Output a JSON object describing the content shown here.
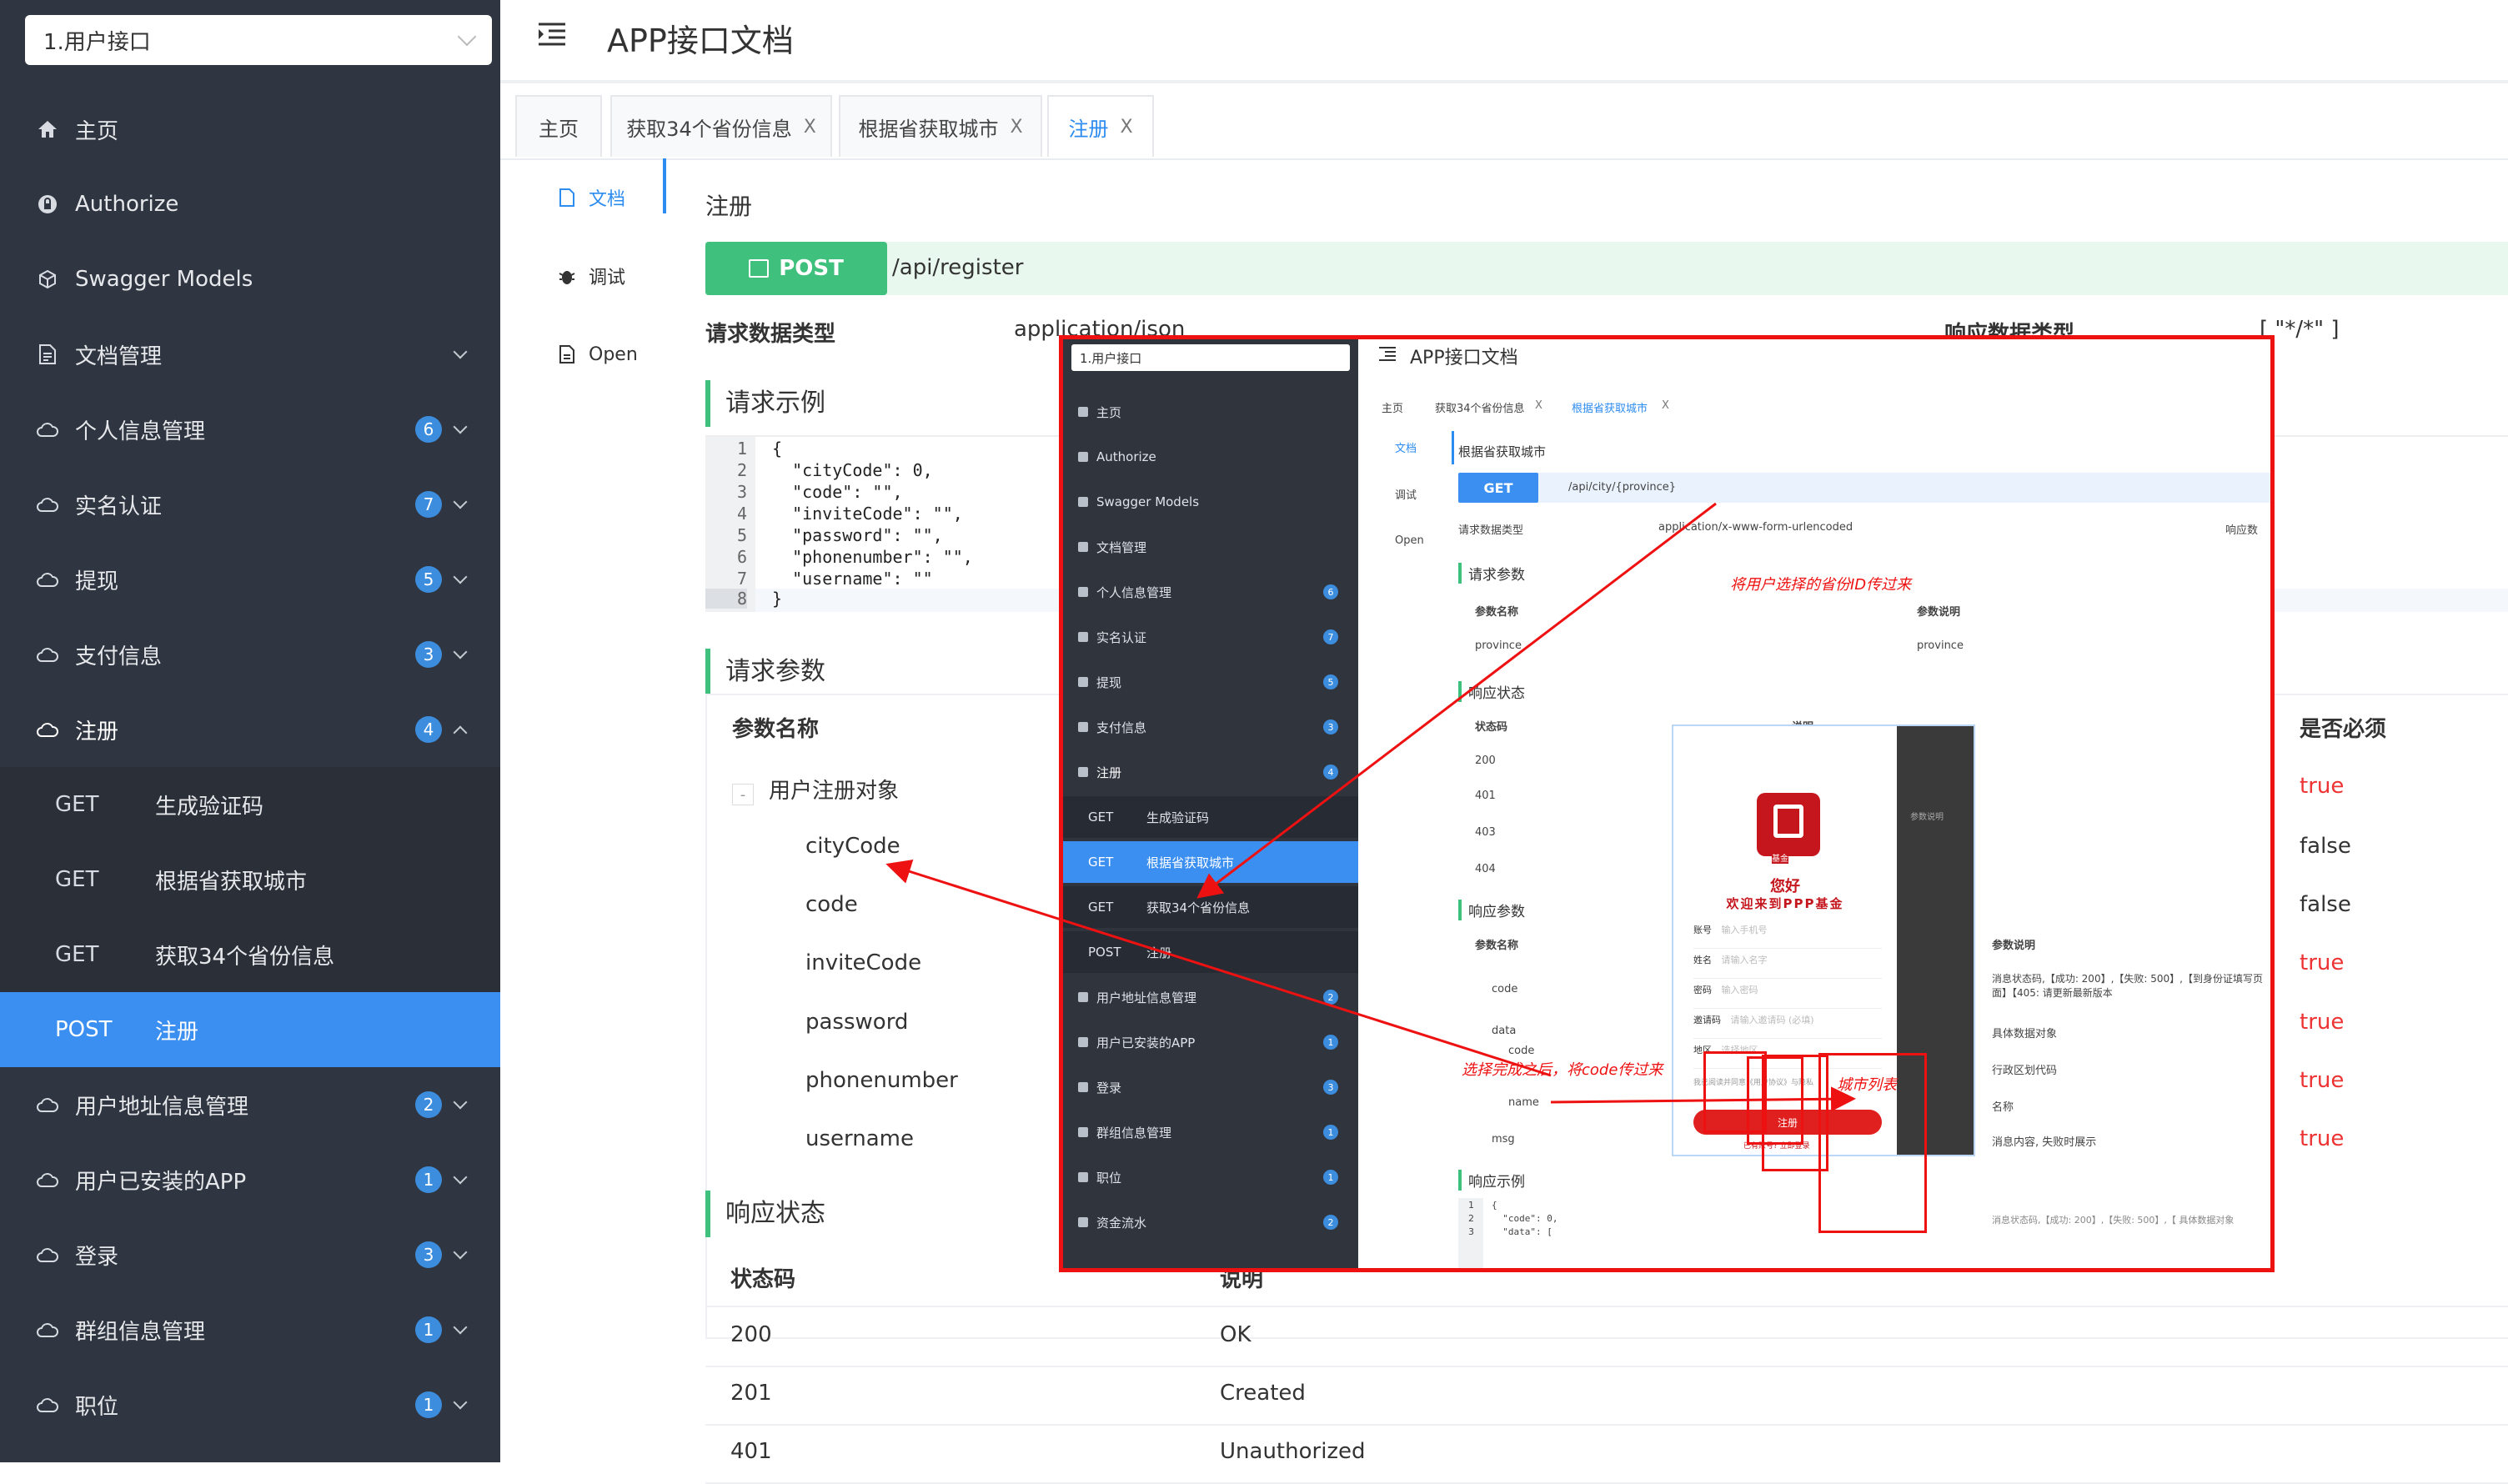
{
  "sidebar": {
    "select_value": "1.用户接口",
    "items": [
      {
        "label": "主页",
        "icon": "home-icon"
      },
      {
        "label": "Authorize",
        "icon": "lock-icon"
      },
      {
        "label": "Swagger Models",
        "icon": "cube-icon"
      },
      {
        "label": "文档管理",
        "icon": "document-icon"
      },
      {
        "label": "个人信息管理",
        "badge": "6",
        "icon": "cloud-icon"
      },
      {
        "label": "实名认证",
        "badge": "7",
        "icon": "cloud-icon"
      },
      {
        "label": "提现",
        "badge": "5",
        "icon": "cloud-icon"
      },
      {
        "label": "支付信息",
        "badge": "3",
        "icon": "cloud-icon"
      },
      {
        "label": "注册",
        "badge": "4",
        "icon": "cloud-icon"
      }
    ],
    "sub_items": [
      {
        "method": "GET",
        "label": "生成验证码"
      },
      {
        "method": "GET",
        "label": "根据省获取城市"
      },
      {
        "method": "GET",
        "label": "获取34个省份信息"
      },
      {
        "method": "POST",
        "label": "注册"
      }
    ],
    "items_after": [
      {
        "label": "用户地址信息管理",
        "badge": "2"
      },
      {
        "label": "用户已安装的APP",
        "badge": "1"
      },
      {
        "label": "登录",
        "badge": "3"
      },
      {
        "label": "群组信息管理",
        "badge": "1"
      },
      {
        "label": "职位",
        "badge": "1"
      }
    ]
  },
  "header": {
    "title": "APP接口文档"
  },
  "tabs": [
    {
      "label": "主页"
    },
    {
      "label": "获取34个省份信息",
      "close": "X"
    },
    {
      "label": "根据省获取城市",
      "close": "X"
    },
    {
      "label": "注册",
      "close": "X"
    }
  ],
  "subnav": [
    {
      "label": "文档"
    },
    {
      "label": "调试"
    },
    {
      "label": "Open"
    }
  ],
  "doc": {
    "title": "注册",
    "method": "POST",
    "path": "/api/register",
    "req_type_label": "请求数据类型",
    "req_type_value": "application/json",
    "resp_type_label": "响应数据类型",
    "resp_type_value": "[ \"*/*\" ]",
    "example_title": "请求示例",
    "code_lines": [
      "{",
      "  \"cityCode\": 0,",
      "  \"code\": \"\",",
      "  \"inviteCode\": \"\",",
      "  \"password\": \"\",",
      "  \"phonenumber\": \"\",",
      "  \"username\": \"\"",
      "}"
    ],
    "line_numbers": [
      "1",
      "2",
      "3",
      "4",
      "5",
      "6",
      "7",
      "8"
    ],
    "params_title": "请求参数",
    "param_col_name": "参数名称",
    "param_col_required": "是否必须",
    "param_group": "用户注册对象",
    "collapse_symbol": "-",
    "params": [
      {
        "name": "cityCode",
        "required": "false"
      },
      {
        "name": "code",
        "required": "false"
      },
      {
        "name": "inviteCode",
        "required": "true"
      },
      {
        "name": "password",
        "required": "true"
      },
      {
        "name": "phonenumber",
        "required": "true"
      },
      {
        "name": "username",
        "required": "true"
      }
    ],
    "group_required": "true",
    "resp_title": "响应状态",
    "resp_col_code": "状态码",
    "resp_col_desc": "说明",
    "responses": [
      {
        "code": "200",
        "desc": "OK"
      },
      {
        "code": "201",
        "desc": "Created"
      },
      {
        "code": "401",
        "desc": "Unauthorized"
      }
    ]
  },
  "embed": {
    "select_value": "1.用户接口",
    "header_title": "APP接口文档",
    "tabs": [
      "主页",
      "获取34个省份信息",
      "根据省获取城市"
    ],
    "tab_close": "X",
    "subnav": [
      "文档",
      "调试",
      "Open"
    ],
    "side_items": [
      {
        "label": "主页"
      },
      {
        "label": "Authorize"
      },
      {
        "label": "Swagger Models"
      },
      {
        "label": "文档管理"
      },
      {
        "label": "个人信息管理",
        "badge": "6"
      },
      {
        "label": "实名认证",
        "badge": "7"
      },
      {
        "label": "提现",
        "badge": "5"
      },
      {
        "label": "支付信息",
        "badge": "3"
      },
      {
        "label": "注册",
        "badge": "4"
      }
    ],
    "side_sub": [
      {
        "method": "GET",
        "label": "生成验证码"
      },
      {
        "method": "GET",
        "label": "根据省获取城市"
      },
      {
        "method": "GET",
        "label": "获取34个省份信息"
      },
      {
        "method": "POST",
        "label": "注册"
      }
    ],
    "side_after": [
      {
        "label": "用户地址信息管理",
        "badge": "2"
      },
      {
        "label": "用户已安装的APP",
        "badge": "1"
      },
      {
        "label": "登录",
        "badge": "3"
      },
      {
        "label": "群组信息管理",
        "badge": "1"
      },
      {
        "label": "职位",
        "badge": "1"
      },
      {
        "label": "资金流水",
        "badge": "2"
      }
    ],
    "api_title": "根据省获取城市",
    "method": "GET",
    "path": "/api/city/{province}",
    "req_type_label": "请求数据类型",
    "req_type_value": "application/x-www-form-urlencoded",
    "resp_type_label": "响应数",
    "req_params_title": "请求参数",
    "param_name_col": "参数名称",
    "param_desc_col": "参数说明",
    "param_row_name": "province",
    "param_row_desc": "province",
    "resp_status_title": "响应状态",
    "status_col": "状态码",
    "desc_col": "说明",
    "status_codes": [
      "200",
      "401",
      "403",
      "404"
    ],
    "resp_params_title": "响应参数",
    "resp_param_col": "参数名称",
    "resp_param_desc_col": "参数说明",
    "resp_rows": [
      {
        "name": "code",
        "desc": "消息状态码,【成功: 200】,【失败: 500】,【到身份证填写页面】【405: 请更新最新版本"
      },
      {
        "name": "data",
        "desc": "具体数据对象"
      },
      {
        "name": "code",
        "desc": "行政区划代码"
      },
      {
        "name": "name",
        "desc": "名称"
      },
      {
        "name": "msg",
        "desc": "消息内容, 失败时展示"
      }
    ],
    "resp_example_title": "响应示例",
    "code_lines": [
      "{",
      "  \"code\": 0,",
      "  \"data\": ["
    ],
    "code_ln": [
      "1",
      "2",
      "3"
    ],
    "code_tail": "消息状态码,【成功: 200】,【失败: 500】,【 具体数据对象",
    "phone": {
      "hello": "您好",
      "welcome": "欢迎来到PPP基金",
      "brand": "基金",
      "fields": [
        {
          "label": "账号",
          "placeholder": "输入手机号"
        },
        {
          "label": "姓名",
          "placeholder": "请输入名字"
        },
        {
          "label": "密码",
          "placeholder": "输入密码"
        },
        {
          "label": "邀请码",
          "placeholder": "请输入邀请码 (必填)"
        },
        {
          "label": "地区",
          "placeholder": "选择地区"
        }
      ],
      "agree": "我已阅读并同意《用户协议》与隐私",
      "register": "注册",
      "login_link": "已有账号? 立即登录",
      "side_text": "参数说明"
    }
  },
  "annotations": {
    "note1": "将用户选择的省份ID传过来",
    "note2": "选择完成之后，将code传过来",
    "note3": "城市列表"
  },
  "colors": {
    "sidebar": "#303641",
    "accent": "#3b8ff0",
    "post": "#3fc07c",
    "annotation": "#e11"
  }
}
